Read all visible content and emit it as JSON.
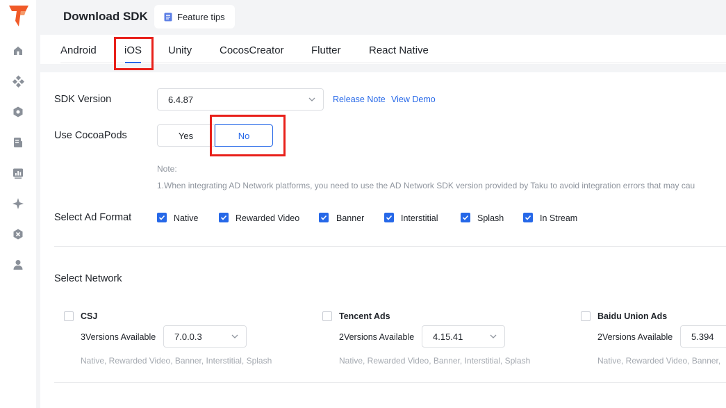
{
  "header": {
    "title": "Download SDK",
    "feature_tips": "Feature tips"
  },
  "sidebar": {
    "icons": [
      "home-icon",
      "apps-icon",
      "settings-icon",
      "document-icon",
      "report-icon",
      "sparkle-icon",
      "network-icon",
      "user-icon"
    ]
  },
  "tabs": [
    "Android",
    "iOS",
    "Unity",
    "CocosCreator",
    "Flutter",
    "React Native"
  ],
  "active_tab": "iOS",
  "sdk_version": {
    "label": "SDK Version",
    "value": "6.4.87",
    "release_note": "Release Note",
    "view_demo": "View Demo"
  },
  "cocoapods": {
    "label": "Use CocoaPods",
    "yes": "Yes",
    "no": "No",
    "selected": "No"
  },
  "note": {
    "title": "Note:",
    "text": "1.When integrating AD Network platforms, you need to use the AD Network SDK version provided by Taku to avoid integration errors that may cau"
  },
  "ad_format": {
    "label": "Select Ad Format",
    "options": [
      {
        "label": "Native",
        "checked": true
      },
      {
        "label": "Rewarded Video",
        "checked": true
      },
      {
        "label": "Banner",
        "checked": true
      },
      {
        "label": "Interstitial",
        "checked": true
      },
      {
        "label": "Splash",
        "checked": true
      },
      {
        "label": "In Stream",
        "checked": true
      }
    ]
  },
  "network": {
    "label": "Select Network",
    "items": [
      {
        "name": "CSJ",
        "available": "3Versions Available",
        "version": "7.0.0.3",
        "formats": "Native, Rewarded Video, Banner, Interstitial, Splash",
        "checked": false
      },
      {
        "name": "Tencent Ads",
        "available": "2Versions Available",
        "version": "4.15.41",
        "formats": "Native, Rewarded Video, Banner, Interstitial, Splash",
        "checked": false
      },
      {
        "name": "Baidu Union Ads",
        "available": "2Versions Available",
        "version": "5.394",
        "formats": "Native, Rewarded Video, Banner,",
        "checked": false
      }
    ]
  },
  "colors": {
    "accent": "#2668e8",
    "brand": "#f05a28",
    "highlight": "#e8201a"
  }
}
